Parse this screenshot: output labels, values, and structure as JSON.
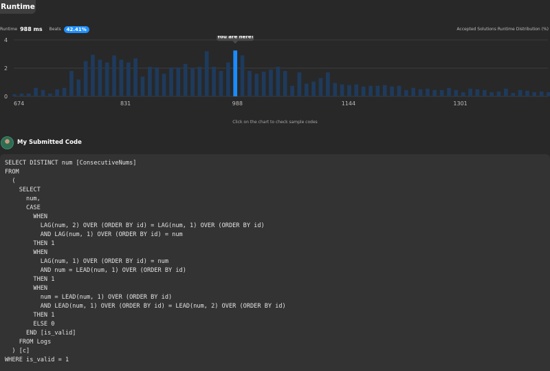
{
  "header": {
    "tab_label": "Runtime"
  },
  "stats": {
    "runtime_label": "Runtime",
    "runtime_value": "988 ms",
    "beats_label": "Beats",
    "beats_value": "42.41%"
  },
  "distribution_label": "Accepted Solutions Runtime Distribution (%)",
  "tooltip": "You are here!",
  "hint": "Click on the chart to check sample codes",
  "submission": {
    "title": "My Submitted Code"
  },
  "colors": {
    "bar": "#1e3a5c",
    "bar_highlight": "#1a8cff",
    "accent": "#1f8fff"
  },
  "chart_data": {
    "type": "bar",
    "xlabel": "",
    "ylabel": "",
    "ylim": [
      0,
      4
    ],
    "yticks": [
      0,
      2,
      4
    ],
    "xlim": [
      674,
      1424
    ],
    "xticks": [
      674,
      831,
      988,
      1144,
      1301
    ],
    "highlight_x": 988,
    "bin_width": 10,
    "x": [
      675,
      685,
      695,
      705,
      715,
      725,
      735,
      745,
      755,
      765,
      775,
      785,
      795,
      805,
      815,
      825,
      835,
      845,
      855,
      865,
      875,
      885,
      895,
      905,
      915,
      925,
      935,
      945,
      955,
      965,
      975,
      985,
      995,
      1005,
      1015,
      1025,
      1035,
      1045,
      1055,
      1065,
      1075,
      1085,
      1095,
      1105,
      1115,
      1125,
      1135,
      1145,
      1155,
      1165,
      1175,
      1185,
      1195,
      1205,
      1215,
      1225,
      1235,
      1245,
      1255,
      1265,
      1275,
      1285,
      1295,
      1305,
      1315,
      1325,
      1335,
      1345,
      1355,
      1365,
      1375,
      1385,
      1395,
      1405,
      1415,
      1425
    ],
    "values": [
      0.15,
      0.2,
      0.2,
      0.6,
      0.45,
      0.2,
      0.5,
      0.6,
      1.8,
      1.2,
      2.5,
      2.95,
      2.6,
      2.4,
      2.9,
      2.6,
      2.4,
      2.7,
      1.4,
      2.1,
      2.05,
      1.6,
      2.05,
      2.05,
      2.3,
      2.0,
      2.1,
      3.2,
      2.1,
      1.8,
      2.4,
      3.25,
      2.9,
      1.8,
      1.6,
      1.75,
      1.9,
      2.1,
      1.8,
      0.75,
      1.7,
      0.9,
      1.05,
      1.3,
      1.7,
      0.95,
      0.85,
      0.8,
      0.85,
      0.7,
      0.75,
      0.75,
      0.8,
      0.7,
      0.75,
      0.45,
      0.6,
      0.5,
      0.55,
      0.45,
      0.45,
      0.6,
      0.45,
      0.3,
      0.55,
      0.5,
      0.45,
      0.3,
      0.35,
      0.55,
      0.25,
      0.45,
      0.4,
      0.3,
      0.35,
      0.3
    ]
  },
  "code": [
    "SELECT DISTINCT num [ConsecutiveNums]",
    "FROM",
    "  (",
    "    SELECT",
    "      num,",
    "      CASE",
    "        WHEN",
    "          LAG(num, 2) OVER (ORDER BY id) = LAG(num, 1) OVER (ORDER BY id)",
    "          AND LAG(num, 1) OVER (ORDER BY id) = num",
    "        THEN 1",
    "        WHEN",
    "          LAG(num, 1) OVER (ORDER BY id) = num",
    "          AND num = LEAD(num, 1) OVER (ORDER BY id)",
    "        THEN 1",
    "        WHEN",
    "          num = LEAD(num, 1) OVER (ORDER BY id)",
    "          AND LEAD(num, 1) OVER (ORDER BY id) = LEAD(num, 2) OVER (ORDER BY id)",
    "        THEN 1",
    "        ELSE 0",
    "      END [is_valid]",
    "    FROM Logs",
    "  ) [c]",
    "WHERE is_valid = 1"
  ]
}
